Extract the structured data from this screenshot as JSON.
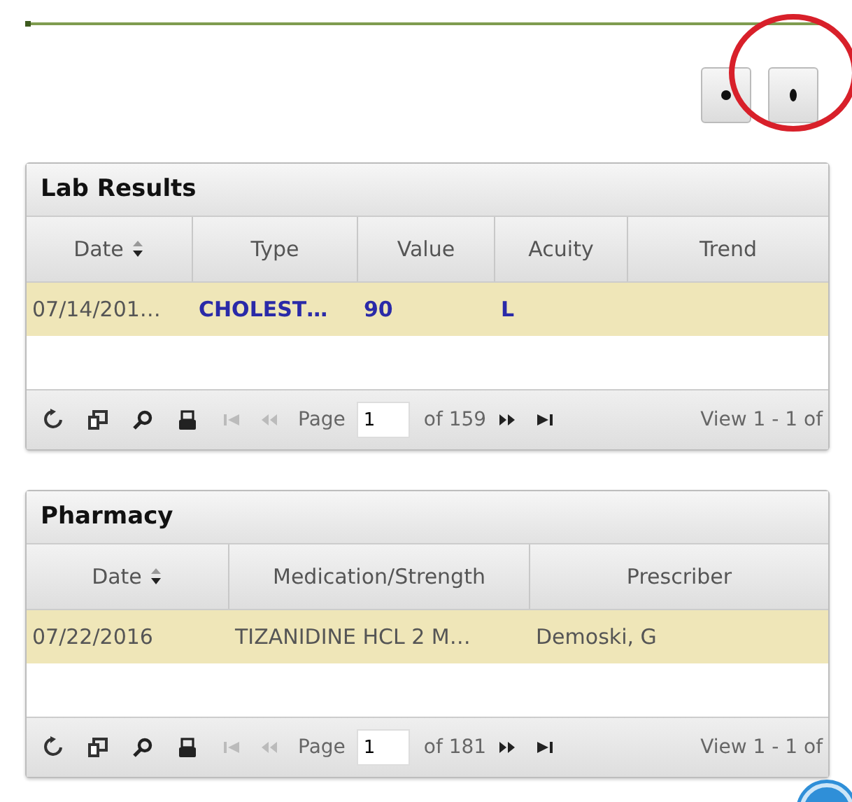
{
  "toolbar": {
    "buttons": [
      {
        "kind": "dot"
      },
      {
        "kind": "dots"
      }
    ]
  },
  "annotation": {
    "kind": "circle"
  },
  "panels": [
    {
      "title": "Lab Results",
      "columns": [
        {
          "label": "Date",
          "sortable": true
        },
        {
          "label": "Type",
          "sortable": false
        },
        {
          "label": "Value",
          "sortable": false
        },
        {
          "label": "Acuity",
          "sortable": false
        },
        {
          "label": "Trend",
          "sortable": false
        }
      ],
      "rows": [
        {
          "selected": true,
          "cells": [
            {
              "text": "07/14/201…",
              "kind": "text"
            },
            {
              "text": "CHOLEST…",
              "kind": "link"
            },
            {
              "text": "90",
              "kind": "link"
            },
            {
              "text": "L",
              "kind": "link"
            }
          ]
        }
      ],
      "pager": {
        "label": "Page",
        "page": "1",
        "total": "of 159",
        "view": "View 1 - 1 of",
        "nav": [
          {
            "kind": "first",
            "disabled": true
          },
          {
            "kind": "prev",
            "disabled": true
          },
          {
            "kind": "next",
            "disabled": false
          },
          {
            "kind": "last",
            "disabled": false
          }
        ]
      }
    },
    {
      "title": "Pharmacy",
      "columns": [
        {
          "label": "Date",
          "sortable": true
        },
        {
          "label": "Medication/Strength",
          "sortable": false
        },
        {
          "label": "Prescriber",
          "sortable": false
        }
      ],
      "rows": [
        {
          "selected": true,
          "cells": [
            {
              "text": "07/22/2016",
              "kind": "text"
            },
            {
              "text": "TIZANIDINE HCL 2 M…",
              "kind": "text"
            },
            {
              "text": "Demoski, G",
              "kind": "text"
            }
          ]
        }
      ],
      "pager": {
        "label": "Page",
        "page": "1",
        "total": "of 181",
        "view": "View 1 - 1 of",
        "nav": [
          {
            "kind": "first",
            "disabled": true
          },
          {
            "kind": "prev",
            "disabled": true
          },
          {
            "kind": "next",
            "disabled": false
          },
          {
            "kind": "last",
            "disabled": false
          }
        ]
      }
    }
  ]
}
